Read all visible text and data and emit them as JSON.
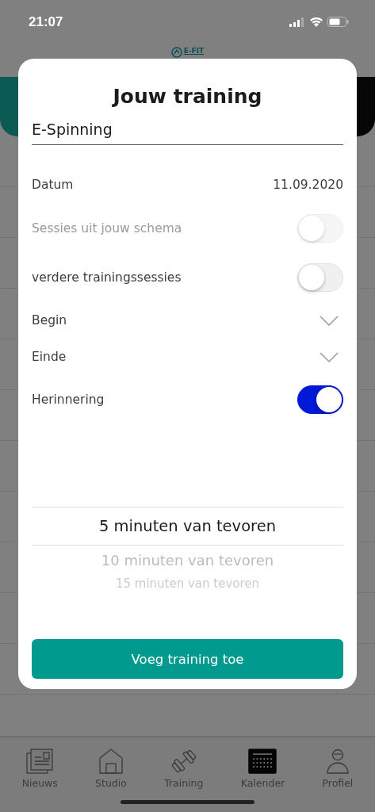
{
  "status_bar": {
    "time": "21:07"
  },
  "header": {
    "logo": "E-FIT"
  },
  "dialog": {
    "title": "Jouw training",
    "name_field": {
      "value": "E-Spinning"
    },
    "rows": [
      {
        "kind": "value",
        "label": "Datum",
        "value": "11.09.2020",
        "disabled": false
      },
      {
        "kind": "toggle",
        "label": "Sessies uit jouw schema",
        "on": false,
        "disabled": true
      },
      {
        "kind": "toggle",
        "label": "verdere trainingssessies",
        "on": false,
        "disabled": false
      },
      {
        "kind": "dropdown",
        "label": "Begin",
        "disabled": false
      },
      {
        "kind": "dropdown",
        "label": "Einde",
        "disabled": false
      },
      {
        "kind": "toggle",
        "label": "Herinnering",
        "on": true,
        "disabled": false
      }
    ],
    "reminder_picker": [
      {
        "label": "5 minuten van tevoren",
        "selected": true
      },
      {
        "label": "10 minuten van tevoren",
        "selected": false
      },
      {
        "label": "15 minuten van tevoren",
        "selected": false
      }
    ],
    "button": "Voeg training toe"
  },
  "tab_bar": [
    {
      "kind": "news",
      "label": "Nieuws",
      "selected": false
    },
    {
      "kind": "home",
      "label": "Studio",
      "selected": false
    },
    {
      "kind": "dumbbell",
      "label": "Training",
      "selected": false
    },
    {
      "kind": "calendar",
      "label": "Kalender",
      "selected": true
    },
    {
      "kind": "person",
      "label": "Profiel",
      "selected": false
    }
  ]
}
